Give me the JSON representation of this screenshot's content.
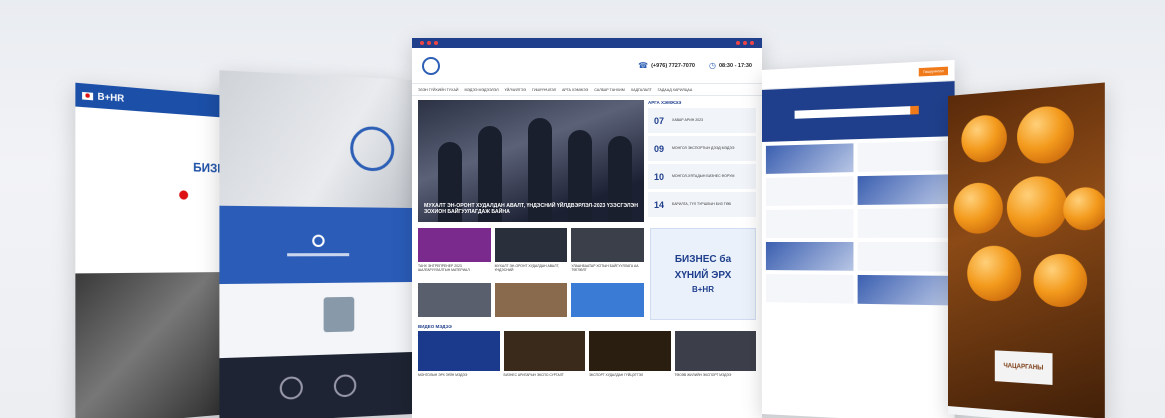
{
  "left_panel": {
    "logo": "B+HR",
    "heading_fragment": "БИЗНЕ"
  },
  "center": {
    "contact_phone": "(+976) 7727-7070",
    "contact_hours": "08:30 - 17:30",
    "nav": [
      "ЭЗЭН ГҮЙХИЙН ТУХАЙ",
      "МЭДЭЭ МЭДЭЭЛЭЛ",
      "ҮЙЛЧИЛГЭЭ",
      "ГИШҮҮНЧЛЭЛ",
      "АРГА ХЭМЖЭЭ",
      "САЛБАР ТАНХИМ",
      "ХАДГАЛАЛТ",
      "ГАДААД ХАРИЛЦАА"
    ],
    "hero_caption": "МУХАЛТ ЭН-ОРОНТ ХУДАЛДАН АВАЛТ, ҮНДЭСНИЙ ҮЙЛДВЭРЛЭЛ-2023 ҮЗЭСГЭЛЭН ЗОХИОН БАЙГУУЛАГДАЖ БАЙНА",
    "events_head": "АРГА ХЭМЖЭЭ",
    "events": [
      {
        "day": "07",
        "text": "ХАВАР АРИН 2023"
      },
      {
        "day": "09",
        "text": "МОНГОЛ ЭКСПОРТЫН ДЭЭД МЭДЭЭ"
      },
      {
        "day": "10",
        "text": "МОНГОЛ-ХЯТАДЫН БИЗНЕС ФОРУМ"
      },
      {
        "day": "14",
        "text": "БАРИЛГА, ТҮЛ ТУРШЛЫН БИЗ ТӨВ"
      }
    ],
    "news": [
      {
        "label": "ТАНХ ЭНТРЕПРЕНЕР 2023 ШАЛГАРУУЛАЛТЫН МАТЕРИАЛ",
        "color": "#7a2a8c"
      },
      {
        "label": "МУХАЛТ ЭН-ОРОНТ ХУДАЛДАН АВАЛТ, ҮНДЭСНИЙ",
        "color": "#2a2f3c"
      },
      {
        "label": "УЛААНБААТАР ХОТЫН БАЙГУУЛЛАГА АА ТӨГЛӨЛТ",
        "color": "#3a3f4a"
      },
      {
        "label": "",
        "color": "#5a5f6e"
      },
      {
        "label": "",
        "color": "#8a6a4c"
      },
      {
        "label": "",
        "color": "#3a7bd5"
      }
    ],
    "banner": {
      "line1": "БИЗНЕС ба",
      "line2": "ХҮНИЙ ЭРХ",
      "brand": "B+HR"
    },
    "video_head": "ВИДЕО МЭДЭЭ",
    "videos": [
      {
        "label": "МОНГОЛЫН ЭРХ ЗҮЙН МЭДЭЭ",
        "color": "#1b3a8c"
      },
      {
        "label": "БИЗНЕС АРИГАРЫН ЭКСПО СУРГАЛТ",
        "color": "#3a2a1c"
      },
      {
        "label": "ЭКСПОРТ ХУДАЛДАН ГҮЙЦЭТГЭЛ",
        "color": "#2a1e10"
      },
      {
        "label": "ТӨСӨВ ЖИЛИЙН ЭКСПОРТ МЭДЭЭ",
        "color": "#3c3f4a"
      }
    ]
  },
  "right_panel": {
    "nav_button": "Гишүүнчлэл"
  },
  "far_panel": {
    "tag": "ЧАЦАРГАНЫ"
  }
}
